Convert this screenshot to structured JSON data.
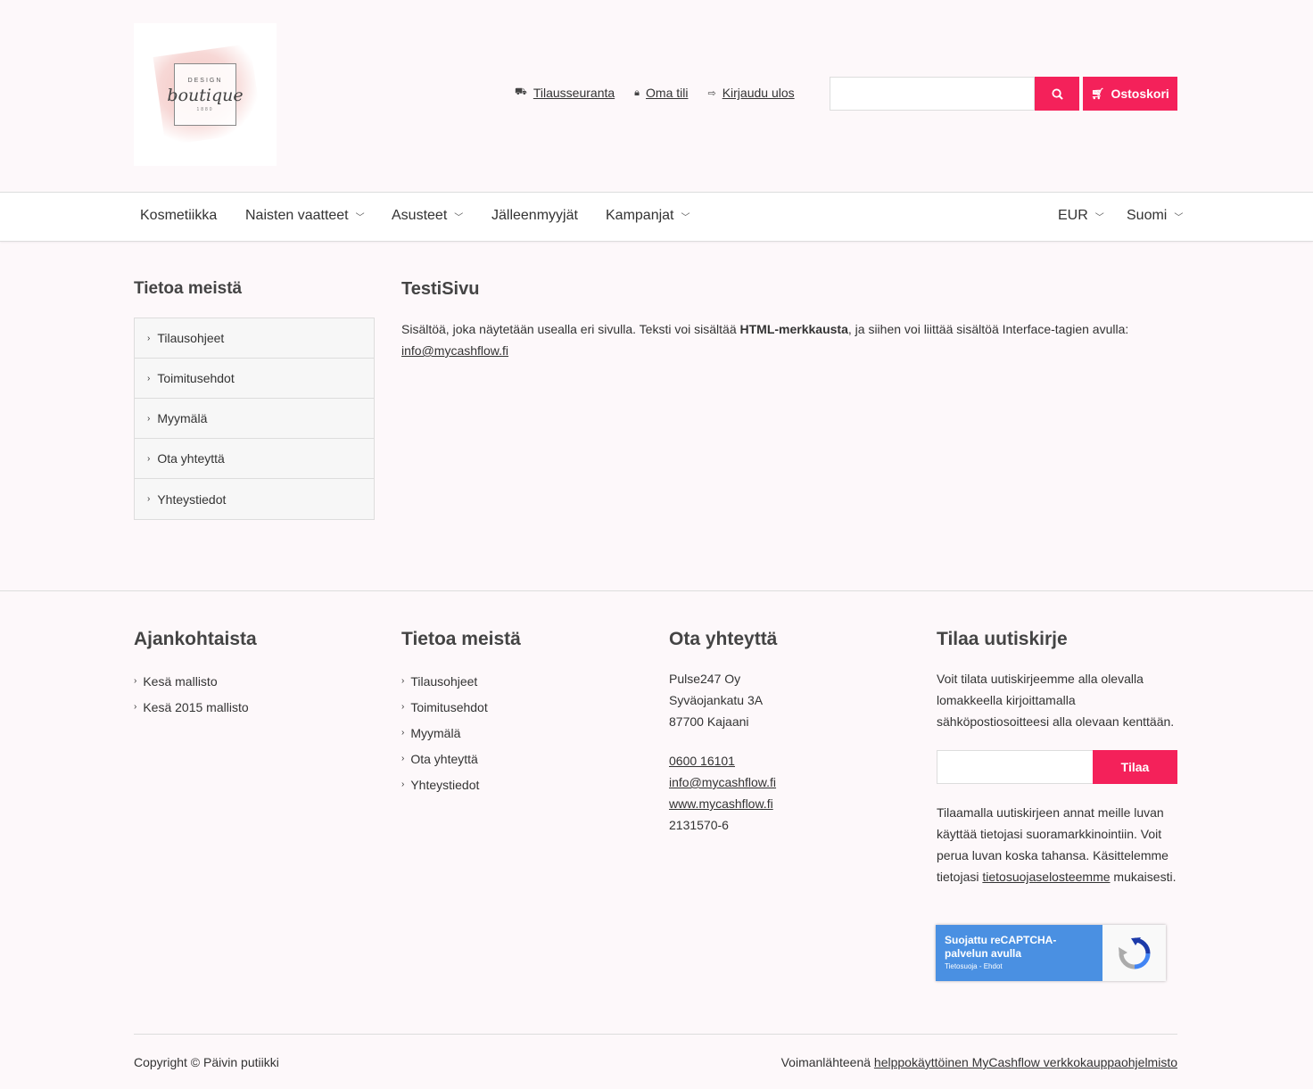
{
  "logo": {
    "line1": "DESIGN",
    "line2": "boutique",
    "line3": "1880"
  },
  "toplinks": [
    {
      "icon": "truck-icon",
      "label": "Tilausseuranta"
    },
    {
      "icon": "lock-icon",
      "label": "Oma tili"
    },
    {
      "icon": "sign-out-icon",
      "label": "Kirjaudu ulos"
    }
  ],
  "search": {
    "placeholder": "",
    "button_icon": "search-icon"
  },
  "cart": {
    "label": "Ostoskori",
    "icon": "cart-icon"
  },
  "nav": {
    "items": [
      {
        "label": "Kosmetiikka"
      },
      {
        "label": "Naisten vaatteet"
      },
      {
        "label": "Asusteet"
      },
      {
        "label": "Jälleenmyyjät"
      },
      {
        "label": "Kampanjat"
      }
    ],
    "currency": "EUR",
    "language": "Suomi"
  },
  "sidebar": {
    "title": "Tietoa meistä",
    "items": [
      {
        "label": "Tilausohjeet"
      },
      {
        "label": "Toimitusehdot"
      },
      {
        "label": "Myymälä"
      },
      {
        "label": "Ota yhteyttä"
      },
      {
        "label": "Yhteystiedot"
      }
    ]
  },
  "main": {
    "title": "TestiSivu",
    "text_before": "Sisältöä, joka näytetään usealla eri sivulla. Teksti voi sisältää ",
    "text_bold": "HTML-merkkausta",
    "text_after": ", ja siihen voi liittää sisältöä Interface-tagien avulla:",
    "email_link": "info@mycashflow.fi"
  },
  "footer": {
    "news": {
      "title": "Ajankohtaista",
      "items": [
        {
          "label": "Kesä mallisto"
        },
        {
          "label": "Kesä 2015 mallisto"
        }
      ]
    },
    "about": {
      "title": "Tietoa meistä",
      "items": [
        {
          "label": "Tilausohjeet"
        },
        {
          "label": "Toimitusehdot"
        },
        {
          "label": "Myymälä"
        },
        {
          "label": "Ota yhteyttä"
        },
        {
          "label": "Yhteystiedot"
        }
      ]
    },
    "contact": {
      "title": "Ota yhteyttä",
      "company": "Pulse247 Oy",
      "street": "Syväojankatu 3A",
      "city": "87700 Kajaani",
      "phone": "0600 16101",
      "email": "info@mycashflow.fi",
      "web": "www.mycashflow.fi",
      "business_id": "2131570-6"
    },
    "newsletter": {
      "title": "Tilaa uutiskirje",
      "text": "Voit tilata uutiskirjeemme alla olevalla lomakkeella kirjoittamalla sähköpostiosoitteesi alla olevaan kenttään.",
      "button": "Tilaa",
      "consent_before": "Tilaamalla uutiskirjeen annat meille luvan käyttää tietojasi suoramarkkinointiin. Voit perua luvan koska tahansa. Käsittelemme tietojasi ",
      "consent_link": "tietosuojaselosteemme",
      "consent_after": " mukaisesti."
    },
    "recaptcha": {
      "main": "Suojattu reCAPTCHA-palvelun avulla",
      "sub": "Tietosuoja - Ehdot"
    },
    "copyright": "Copyright © Päivin putiikki",
    "powered_prefix": "Voimanlähteenä ",
    "powered_link": "helppokäyttöinen MyCashflow verkkokauppaohjelmisto"
  },
  "colors": {
    "accent": "#f4215a",
    "background": "#fdf8fa",
    "recaptcha": "#4a90e2"
  }
}
